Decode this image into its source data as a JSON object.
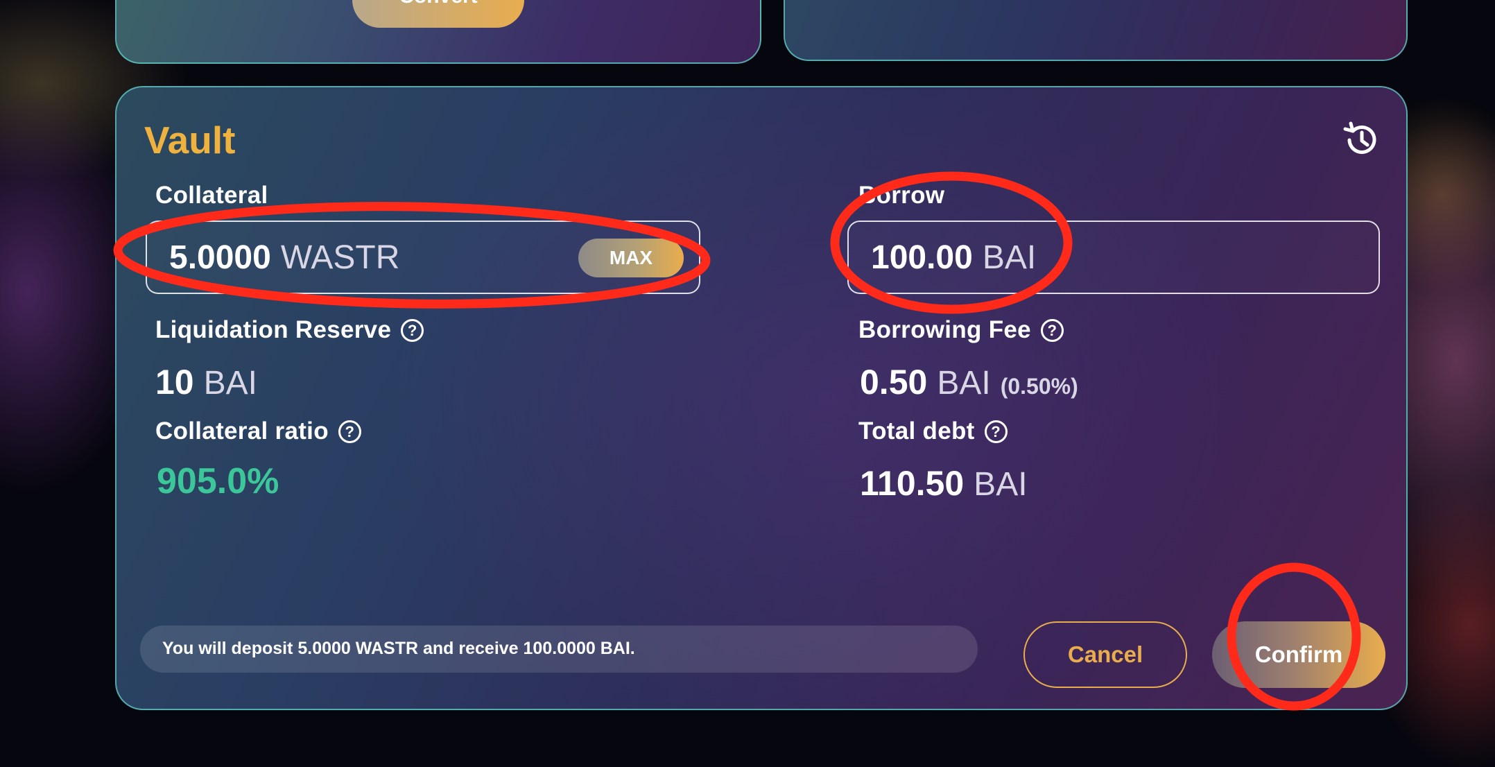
{
  "top": {
    "convert_label": "Convert"
  },
  "vault": {
    "title": "Vault",
    "collateral": {
      "label": "Collateral",
      "value": "5.0000",
      "unit": "WASTR",
      "max_label": "MAX"
    },
    "borrow": {
      "label": "Borrow",
      "value": "100.00",
      "unit": "BAI"
    },
    "liquidation_reserve": {
      "label": "Liquidation Reserve",
      "value": "10",
      "unit": "BAI"
    },
    "borrowing_fee": {
      "label": "Borrowing Fee",
      "value": "0.50",
      "unit": "BAI",
      "percent": "(0.50%)"
    },
    "collateral_ratio": {
      "label": "Collateral ratio",
      "value": "905.0%"
    },
    "total_debt": {
      "label": "Total debt",
      "value": "110.50",
      "unit": "BAI"
    },
    "info_text": "You will deposit 5.0000 WASTR and receive 100.0000 BAI.",
    "cancel_label": "Cancel",
    "confirm_label": "Confirm"
  },
  "icons": {
    "help": "?",
    "history": "history-icon"
  },
  "colors": {
    "accent": "#f0b23f",
    "ratio_green": "#3cc79a",
    "panel_border": "#5fd2c8",
    "annotation": "#ff2a1a"
  }
}
